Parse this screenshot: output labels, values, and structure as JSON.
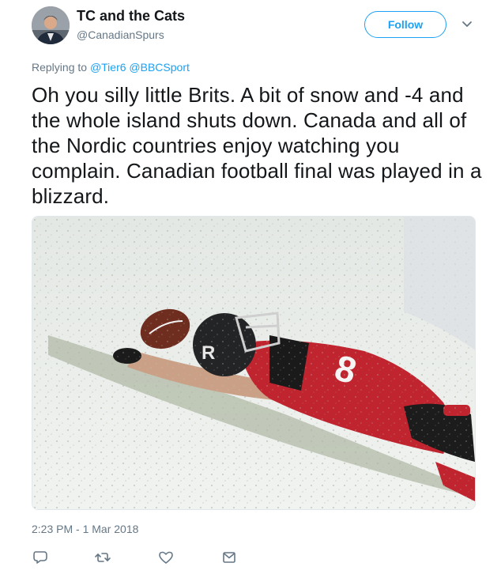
{
  "header": {
    "display_name": "TC and the Cats",
    "handle": "@CanadianSpurs",
    "follow_label": "Follow",
    "avatar_icon": "user-avatar",
    "menu_icon": "chevron-down-icon"
  },
  "reply": {
    "prefix": "Replying to",
    "mentions": [
      "@Tier6",
      "@BBCSport"
    ]
  },
  "tweet": {
    "text": "Oh you silly little Brits. A bit of snow and -4 and the whole island shuts down. Canada and all of the Nordic countries enjoy watching you complain. Canadian football final was played in a blizzard.",
    "timestamp": "2:23 PM - 1 Mar 2018"
  },
  "photo": {
    "jersey_number": "8"
  },
  "actions": {
    "icons": [
      "reply-icon",
      "retweet-icon",
      "like-icon",
      "message-icon"
    ]
  },
  "colors": {
    "accent": "#1da1f2",
    "secondary_text": "#657786",
    "primary_text": "#14171a"
  }
}
